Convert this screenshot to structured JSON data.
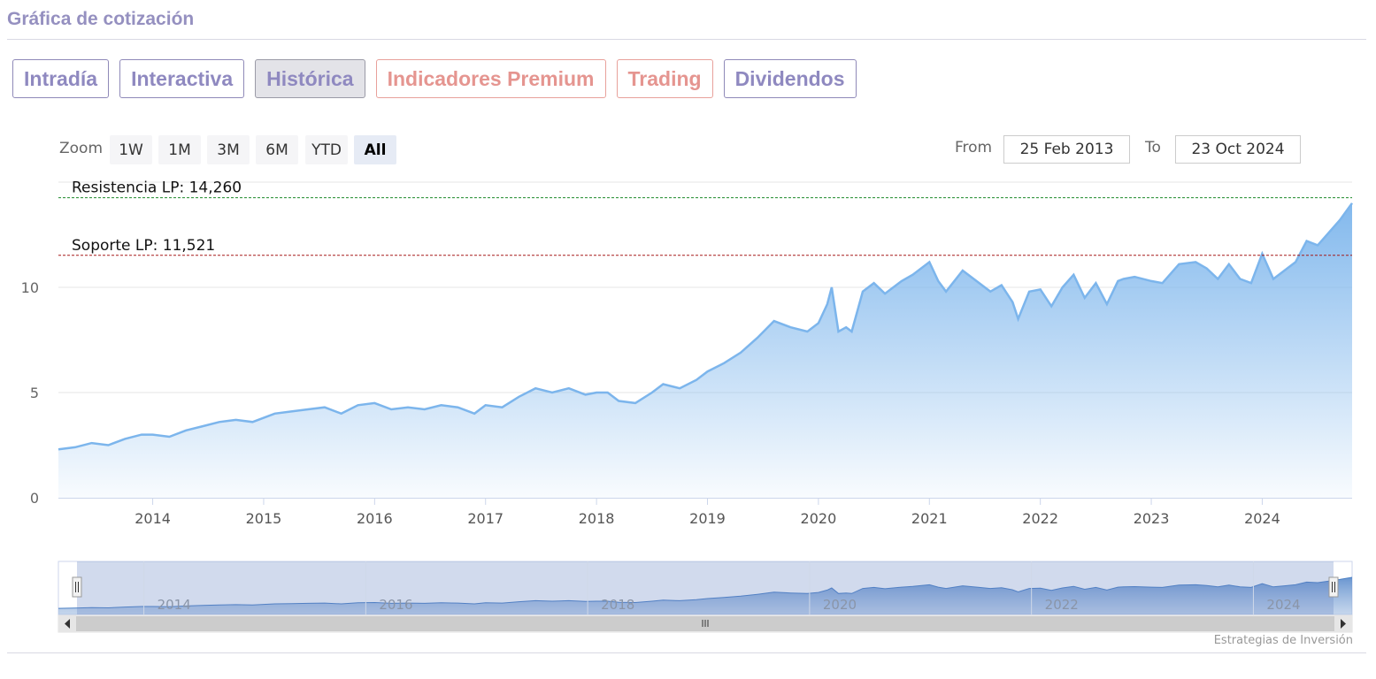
{
  "header": {
    "title": "Gráfica de cotización"
  },
  "tabs": [
    {
      "label": "Intradía",
      "kind": "normal"
    },
    {
      "label": "Interactiva",
      "kind": "normal"
    },
    {
      "label": "Histórica",
      "kind": "active"
    },
    {
      "label": "Indicadores Premium",
      "kind": "premium"
    },
    {
      "label": "Trading",
      "kind": "premium"
    },
    {
      "label": "Dividendos",
      "kind": "normal"
    }
  ],
  "zoom": {
    "label": "Zoom",
    "buttons": [
      "1W",
      "1M",
      "3M",
      "6M",
      "YTD",
      "All"
    ],
    "selected": "All"
  },
  "range": {
    "from_label": "From",
    "from_value": "25 Feb 2013",
    "to_label": "To",
    "to_value": "23 Oct 2024"
  },
  "credit": "Estrategias de Inversión",
  "colors": {
    "series": "#7cb5ec",
    "resistance": "#1e8a2a",
    "support": "#a51a1a",
    "tab_text": "#8f89c0",
    "premium_text": "#e59590"
  },
  "chart_data": {
    "type": "area",
    "ylim": [
      0,
      15
    ],
    "y_ticks": [
      0,
      5,
      10
    ],
    "x_ticks": [
      "2014",
      "2015",
      "2016",
      "2017",
      "2018",
      "2019",
      "2020",
      "2021",
      "2022",
      "2023",
      "2024"
    ],
    "navigator_ticks": [
      "2014",
      "2016",
      "2018",
      "2020",
      "2022",
      "2024"
    ],
    "x_range": [
      2013.15,
      2024.81
    ],
    "series": [
      {
        "x": [
          2013.15,
          2013.3,
          2013.45,
          2013.6,
          2013.75,
          2013.9,
          2014.0,
          2014.15,
          2014.3,
          2014.45,
          2014.6,
          2014.75,
          2014.9,
          2015.0,
          2015.1,
          2015.25,
          2015.4,
          2015.55,
          2015.7,
          2015.85,
          2016.0,
          2016.15,
          2016.3,
          2016.45,
          2016.6,
          2016.75,
          2016.9,
          2017.0,
          2017.15,
          2017.3,
          2017.45,
          2017.6,
          2017.75,
          2017.9,
          2018.0,
          2018.1,
          2018.2,
          2018.35,
          2018.5,
          2018.6,
          2018.75,
          2018.9,
          2019.0,
          2019.15,
          2019.3,
          2019.45,
          2019.6,
          2019.75,
          2019.9,
          2020.0,
          2020.08,
          2020.12,
          2020.18,
          2020.25,
          2020.3,
          2020.4,
          2020.5,
          2020.6,
          2020.75,
          2020.85,
          2021.0,
          2021.08,
          2021.15,
          2021.3,
          2021.45,
          2021.55,
          2021.65,
          2021.75,
          2021.8,
          2021.9,
          2022.0,
          2022.1,
          2022.2,
          2022.3,
          2022.4,
          2022.5,
          2022.6,
          2022.7,
          2022.75,
          2022.85,
          2023.0,
          2023.1,
          2023.25,
          2023.4,
          2023.5,
          2023.6,
          2023.7,
          2023.8,
          2023.9,
          2024.0,
          2024.1,
          2024.2,
          2024.3,
          2024.4,
          2024.5,
          2024.6,
          2024.7,
          2024.81
        ],
        "values": [
          2.3,
          2.4,
          2.6,
          2.5,
          2.8,
          3.0,
          3.0,
          2.9,
          3.2,
          3.4,
          3.6,
          3.7,
          3.6,
          3.8,
          4.0,
          4.1,
          4.2,
          4.3,
          4.0,
          4.4,
          4.5,
          4.2,
          4.3,
          4.2,
          4.4,
          4.3,
          4.0,
          4.4,
          4.3,
          4.8,
          5.2,
          5.0,
          5.2,
          4.9,
          5.0,
          5.0,
          4.6,
          4.5,
          5.0,
          5.4,
          5.2,
          5.6,
          6.0,
          6.4,
          6.9,
          7.6,
          8.4,
          8.1,
          7.9,
          8.3,
          9.2,
          10.0,
          7.9,
          8.1,
          7.9,
          9.8,
          10.2,
          9.7,
          10.3,
          10.6,
          11.2,
          10.3,
          9.8,
          10.8,
          10.2,
          9.8,
          10.1,
          9.3,
          8.5,
          9.8,
          9.9,
          9.1,
          10.0,
          10.6,
          9.5,
          10.2,
          9.2,
          10.3,
          10.4,
          10.5,
          10.3,
          10.2,
          11.1,
          11.2,
          10.9,
          10.4,
          11.1,
          10.4,
          10.2,
          11.6,
          10.4,
          10.8,
          11.2,
          12.2,
          12.0,
          12.6,
          13.2,
          14.0
        ]
      }
    ],
    "lines": [
      {
        "label": "Resistencia LP: 14,260",
        "value": 14.26
      },
      {
        "label": "Soporte LP: 11,521",
        "value": 11.521
      }
    ]
  }
}
